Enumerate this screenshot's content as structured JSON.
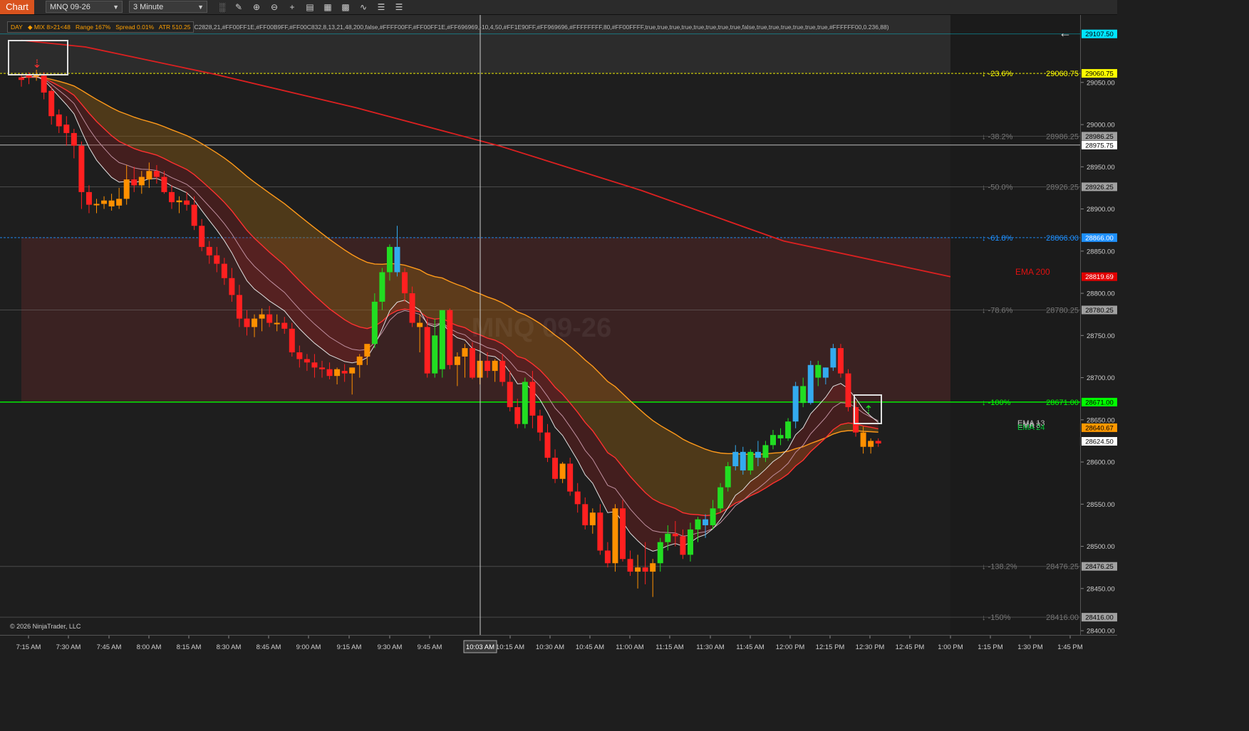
{
  "toolbar": {
    "tab_label": "Chart",
    "instrument": "MNQ 09-26",
    "interval": "3 Minute",
    "icons": [
      "bar-type-icon",
      "draw-icon",
      "zoom-in-icon",
      "zoom-out-icon",
      "crosshair-icon",
      "properties-icon",
      "indicators-icon",
      "strategies-icon",
      "templates-icon",
      "datasheet-icon"
    ]
  },
  "info_bar": {
    "day": "DAY",
    "mix": "◆ MIX 8>21<48",
    "range": "Range 167%",
    "spread": "Spread 0.01%",
    "atr": "ATR 510.25",
    "params": "C2828,21,#FF00FF1E,#FF00B9FF,#FF00C832,8,13,21,48,200,false,#FFFF00FF,#FF00FF1E,#FF696969,-10,4,50,#FF1E90FF,#FF969696,#FFFFFFFF,80,#FF00FFFF,true,true,true,true,true,true,true,true,false,true,true,true,true,true,true,#FFFFFF00,0.236,88)"
  },
  "watermark": "MNQ 09-26",
  "copyright": "© 2026 NinjaTrader, LLC",
  "crosshair_time": "10:03 AM",
  "price_axis": {
    "ticks": [
      "29050.00",
      "29000.00",
      "28950.00",
      "28900.00",
      "28850.00",
      "28800.00",
      "28750.00",
      "28700.00",
      "28650.00",
      "28600.00",
      "28550.00",
      "28500.00",
      "28450.00",
      "28400.00"
    ],
    "tags": [
      {
        "label": "29107.50",
        "bg": "#00e5ff",
        "fg": "#000000",
        "price": 29107.5
      },
      {
        "label": "29060.75",
        "bg": "#ffff00",
        "fg": "#000000",
        "price": 29060.75
      },
      {
        "label": "28986.25",
        "bg": "#a0a0a0",
        "fg": "#000000",
        "price": 28986.25
      },
      {
        "label": "28975.75",
        "bg": "#ffffff",
        "fg": "#000000",
        "price": 28975.75
      },
      {
        "label": "28926.25",
        "bg": "#a0a0a0",
        "fg": "#000000",
        "price": 28926.25
      },
      {
        "label": "28866.00",
        "bg": "#1e90ff",
        "fg": "#ffffff",
        "price": 28866.0
      },
      {
        "label": "28819.69",
        "bg": "#e00000",
        "fg": "#ffffff",
        "price": 28819.69
      },
      {
        "label": "28780.25",
        "bg": "#a0a0a0",
        "fg": "#000000",
        "price": 28780.25
      },
      {
        "label": "28671.00",
        "bg": "#00ff00",
        "fg": "#000000",
        "price": 28671.0
      },
      {
        "label": "28640.67",
        "bg": "#ff9800",
        "fg": "#000000",
        "price": 28640.67
      },
      {
        "label": "28624.50",
        "bg": "#ffffff",
        "fg": "#000000",
        "price": 28624.5
      },
      {
        "label": "28476.25",
        "bg": "#a0a0a0",
        "fg": "#000000",
        "price": 28476.25
      },
      {
        "label": "28416.00",
        "bg": "#a0a0a0",
        "fg": "#000000",
        "price": 28416.0
      }
    ]
  },
  "fib_levels": [
    {
      "pct": "↓ -23.6%",
      "price": 29060.75,
      "value": "29060.75",
      "color": "#ffff00"
    },
    {
      "pct": "↓ -38.2%",
      "price": 28986.25,
      "value": "28986.25",
      "color": "#808080"
    },
    {
      "pct": "↓ -50.0%",
      "price": 28926.25,
      "value": "28926.25",
      "color": "#808080"
    },
    {
      "pct": "↓ -61.8%",
      "price": 28866.0,
      "value": "28866.00",
      "color": "#1e90ff"
    },
    {
      "pct": "↓ -78.6%",
      "price": 28780.25,
      "value": "28780.25",
      "color": "#808080"
    },
    {
      "pct": "↓ -100%",
      "price": 28671.0,
      "value": "28671.00",
      "color": "#00ff00"
    },
    {
      "pct": "↓ -138.2%",
      "price": 28476.25,
      "value": "28476.25",
      "color": "#808080"
    },
    {
      "pct": "↓ -150%",
      "price": 28416.0,
      "value": "28416.00",
      "color": "#808080"
    }
  ],
  "time_axis": [
    "7:15 AM",
    "7:30 AM",
    "7:45 AM",
    "8:00 AM",
    "8:15 AM",
    "8:30 AM",
    "8:45 AM",
    "9:00 AM",
    "9:15 AM",
    "9:30 AM",
    "9:45 AM",
    "10:15 AM",
    "10:30 AM",
    "10:45 AM",
    "11:00 AM",
    "11:15 AM",
    "11:30 AM",
    "11:45 AM",
    "12:00 PM",
    "12:15 PM",
    "12:30 PM",
    "12:45 PM",
    "1:00 PM",
    "1:15 PM",
    "1:30 PM",
    "1:45 PM"
  ],
  "ema_labels": [
    {
      "text": "EMA 200",
      "color": "#e01010",
      "price": 28822
    },
    {
      "text": "EMA 13",
      "color": "#c0c0c0",
      "price": 28645
    },
    {
      "text": "EMA 8",
      "color": "#c0c0c0",
      "price": 28642
    },
    {
      "text": "EMA 24",
      "color": "#00c832",
      "price": 28637
    }
  ],
  "colors": {
    "bear": "#ff2020",
    "bear_pullback": "#ff9000",
    "bull": "#22dd22",
    "bull_strong": "#33aaee",
    "ema200": "#dd2020",
    "ema48": "#ff9a1a",
    "ema21": "#ff3030",
    "ema8": "#e0e0e0",
    "ema13": "#c090a0"
  },
  "chart_data": {
    "type": "candlestick",
    "interval": "3 Minute",
    "ylim": [
      28395,
      29130
    ],
    "x_range": [
      "7:15 AM",
      "1:45 PM"
    ],
    "ohlc": [
      [
        29053,
        29060,
        29045,
        29056
      ],
      [
        29056,
        29062,
        29048,
        29060
      ],
      [
        29060,
        29065,
        29052,
        29057
      ],
      [
        29058,
        29062,
        29030,
        29038
      ],
      [
        29040,
        29045,
        29000,
        29010
      ],
      [
        29012,
        29018,
        28990,
        28998
      ],
      [
        29000,
        29010,
        28975,
        28990
      ],
      [
        28990,
        28995,
        28960,
        28975
      ],
      [
        28975,
        28980,
        28900,
        28920
      ],
      [
        28920,
        28928,
        28895,
        28905
      ],
      [
        28905,
        28912,
        28895,
        28906
      ],
      [
        28906,
        28915,
        28900,
        28910
      ],
      [
        28910,
        28918,
        28898,
        28903
      ],
      [
        28904,
        28925,
        28900,
        28912
      ],
      [
        28912,
        28952,
        28905,
        28935
      ],
      [
        28935,
        28950,
        28920,
        28928
      ],
      [
        28928,
        28945,
        28918,
        28938
      ],
      [
        28935,
        28955,
        28925,
        28945
      ],
      [
        28945,
        28952,
        28930,
        28938
      ],
      [
        28938,
        28945,
        28918,
        28920
      ],
      [
        28920,
        28928,
        28900,
        28908
      ],
      [
        28908,
        28915,
        28895,
        28910
      ],
      [
        28910,
        28920,
        28898,
        28905
      ],
      [
        28905,
        28915,
        28875,
        28880
      ],
      [
        28880,
        28888,
        28850,
        28855
      ],
      [
        28855,
        28862,
        28835,
        28845
      ],
      [
        28845,
        28855,
        28825,
        28835
      ],
      [
        28835,
        28842,
        28810,
        28818
      ],
      [
        28818,
        28830,
        28790,
        28798
      ],
      [
        28798,
        28810,
        28760,
        28770
      ],
      [
        28770,
        28780,
        28750,
        28760
      ],
      [
        28760,
        28775,
        28748,
        28770
      ],
      [
        28770,
        28782,
        28755,
        28775
      ],
      [
        28775,
        28785,
        28760,
        28765
      ],
      [
        28765,
        28775,
        28755,
        28765
      ],
      [
        28765,
        28772,
        28752,
        28758
      ],
      [
        28758,
        28765,
        28725,
        28730
      ],
      [
        28730,
        28738,
        28712,
        28722
      ],
      [
        28722,
        28728,
        28708,
        28718
      ],
      [
        28718,
        28728,
        28700,
        28712
      ],
      [
        28712,
        28720,
        28700,
        28710
      ],
      [
        28710,
        28718,
        28698,
        28702
      ],
      [
        28702,
        28712,
        28692,
        28710
      ],
      [
        28708,
        28716,
        28695,
        28705
      ],
      [
        28705,
        28712,
        28680,
        28712
      ],
      [
        28715,
        28728,
        28700,
        28725
      ],
      [
        28725,
        28735,
        28715,
        28740
      ],
      [
        28740,
        28800,
        28735,
        28790
      ],
      [
        28790,
        28830,
        28780,
        28825
      ],
      [
        28825,
        28858,
        28815,
        28855
      ],
      [
        28855,
        28880,
        28820,
        28825
      ],
      [
        28825,
        28830,
        28790,
        28800
      ],
      [
        28800,
        28808,
        28760,
        28765
      ],
      [
        28765,
        28775,
        28730,
        28760
      ],
      [
        28760,
        28770,
        28700,
        28705
      ],
      [
        28705,
        28770,
        28700,
        28750
      ],
      [
        28710,
        28780,
        28700,
        28780
      ],
      [
        28780,
        28782,
        28710,
        28715
      ],
      [
        28715,
        28730,
        28690,
        28725
      ],
      [
        28725,
        28740,
        28700,
        28735
      ],
      [
        28735,
        28742,
        28698,
        28700
      ],
      [
        28700,
        28728,
        28692,
        28720
      ],
      [
        28720,
        28730,
        28700,
        28708
      ],
      [
        28708,
        28722,
        28695,
        28720
      ],
      [
        28720,
        28728,
        28690,
        28695
      ],
      [
        28695,
        28708,
        28660,
        28665
      ],
      [
        28665,
        28675,
        28640,
        28645
      ],
      [
        28645,
        28700,
        28640,
        28695
      ],
      [
        28695,
        28708,
        28640,
        28655
      ],
      [
        28655,
        28662,
        28625,
        28635
      ],
      [
        28635,
        28645,
        28600,
        28605
      ],
      [
        28605,
        28615,
        28575,
        28580
      ],
      [
        28580,
        28600,
        28575,
        28598
      ],
      [
        28598,
        28605,
        28560,
        28565
      ],
      [
        28565,
        28575,
        28540,
        28550
      ],
      [
        28550,
        28558,
        28520,
        28525
      ],
      [
        28525,
        28545,
        28515,
        28540
      ],
      [
        28540,
        28550,
        28490,
        28495
      ],
      [
        28495,
        28505,
        28475,
        28480
      ],
      [
        28480,
        28550,
        28470,
        28545
      ],
      [
        28545,
        28555,
        28482,
        28485
      ],
      [
        28485,
        28495,
        28465,
        28470
      ],
      [
        28470,
        28490,
        28450,
        28475
      ],
      [
        28475,
        28505,
        28455,
        28470
      ],
      [
        28470,
        28485,
        28440,
        28480
      ],
      [
        28480,
        28510,
        28470,
        28505
      ],
      [
        28505,
        28525,
        28495,
        28515
      ],
      [
        28515,
        28530,
        28500,
        28512
      ],
      [
        28512,
        28520,
        28485,
        28490
      ],
      [
        28490,
        28528,
        28482,
        28520
      ],
      [
        28520,
        28535,
        28505,
        28532
      ],
      [
        28532,
        28538,
        28510,
        28525
      ],
      [
        28525,
        28555,
        28520,
        28545
      ],
      [
        28545,
        28575,
        28540,
        28570
      ],
      [
        28570,
        28600,
        28565,
        28595
      ],
      [
        28595,
        28620,
        28590,
        28612
      ],
      [
        28612,
        28618,
        28585,
        28590
      ],
      [
        28590,
        28615,
        28585,
        28612
      ],
      [
        28612,
        28625,
        28595,
        28605
      ],
      [
        28605,
        28625,
        28600,
        28620
      ],
      [
        28620,
        28638,
        28615,
        28632
      ],
      [
        28632,
        28640,
        28620,
        28628
      ],
      [
        28628,
        28652,
        28625,
        28648
      ],
      [
        28648,
        28695,
        28640,
        28690
      ],
      [
        28690,
        28700,
        28665,
        28670
      ],
      [
        28670,
        28720,
        28668,
        28715
      ],
      [
        28715,
        28720,
        28690,
        28700
      ],
      [
        28700,
        28712,
        28692,
        28712
      ],
      [
        28712,
        28740,
        28708,
        28735
      ],
      [
        28735,
        28740,
        28700,
        28705
      ],
      [
        28705,
        28710,
        28660,
        28665
      ],
      [
        28665,
        28672,
        28630,
        28635
      ],
      [
        28635,
        28642,
        28610,
        28618
      ],
      [
        28618,
        28628,
        28610,
        28625
      ],
      [
        28625,
        28628,
        28618,
        28622
      ]
    ],
    "candle_colors": [
      "bear",
      "bear",
      "bear_pullback",
      "bear",
      "bear",
      "bear",
      "bear",
      "bear",
      "bear",
      "bear",
      "bear_pullback",
      "bear_pullback",
      "bear_pullback",
      "bear_pullback",
      "bear_pullback",
      "bear",
      "bear_pullback",
      "bear_pullback",
      "bear",
      "bear",
      "bear",
      "bear_pullback",
      "bear",
      "bear",
      "bear",
      "bear",
      "bear",
      "bear",
      "bear",
      "bear",
      "bear",
      "bear_pullback",
      "bear_pullback",
      "bear",
      "bear_pullback",
      "bear",
      "bear",
      "bear",
      "bear",
      "bear",
      "bear",
      "bear",
      "bear_pullback",
      "bear",
      "bear_pullback",
      "bear_pullback",
      "bear_pullback",
      "bull",
      "bull",
      "bull",
      "bull_strong",
      "bear",
      "bear",
      "bear_pullback",
      "bear",
      "bull",
      "bull",
      "bear",
      "bear_pullback",
      "bear_pullback",
      "bear",
      "bear_pullback",
      "bear",
      "bear_pullback",
      "bear",
      "bear",
      "bear",
      "bull",
      "bear",
      "bear",
      "bear",
      "bear",
      "bear_pullback",
      "bear",
      "bear",
      "bear",
      "bear_pullback",
      "bear",
      "bear",
      "bear_pullback",
      "bear",
      "bear",
      "bear_pullback",
      "bear",
      "bear_pullback",
      "bull",
      "bull",
      "bear",
      "bear",
      "bull",
      "bull",
      "bull_strong",
      "bull",
      "bull",
      "bull",
      "bull_strong",
      "bull_strong",
      "bull",
      "bull_strong",
      "bull",
      "bull",
      "bull",
      "bull",
      "bull_strong",
      "bull",
      "bull_strong",
      "bull",
      "bull_strong",
      "bull_strong",
      "bear",
      "bear",
      "bear",
      "bear_pullback",
      "bear_pullback",
      "bear"
    ],
    "series": [
      {
        "name": "EMA 200",
        "values": [
          29100,
          29040,
          28980,
          28925,
          28870,
          28819.69
        ]
      },
      {
        "name": "EMA 48"
      },
      {
        "name": "EMA 21"
      },
      {
        "name": "EMA 13"
      },
      {
        "name": "EMA 8"
      },
      {
        "name": "EMA 24"
      }
    ],
    "signals": [
      {
        "type": "sell",
        "bar": 2
      },
      {
        "type": "buy",
        "bar": 107
      }
    ]
  }
}
